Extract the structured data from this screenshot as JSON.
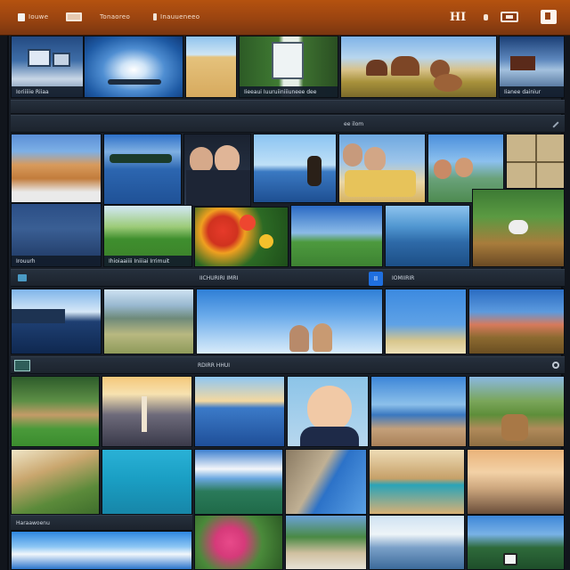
{
  "app": {
    "menu": [
      {
        "label": "Iouwe",
        "icon": "folder-icon"
      },
      {
        "label": "",
        "icon": "image-icon"
      },
      {
        "label": "Tonaoreo",
        "icon": ""
      },
      {
        "label": "Inauueneeo",
        "icon": "menu-icon"
      }
    ],
    "actions": {
      "grid_label": "HI",
      "share_icon": "share-icon",
      "user_icon": "person-icon",
      "close_icon": "close-icon"
    },
    "accent": "#a44a10"
  },
  "sections": {
    "s1": {
      "title": "",
      "right_label": "ee ilom"
    },
    "s2": {
      "title": "",
      "center_label": "IICHURIRI IMRI",
      "count_badge": "II",
      "right_label": "IOMIIRIR"
    },
    "s3": {
      "title": "",
      "center_label": "RDIRR HHUI"
    },
    "s4": {
      "title": "Haraawoenu"
    }
  },
  "captions": {
    "r1_t1": "Ioriiiiie Riiaa",
    "r1_t4": "Iieeaui Iuuruiiniiiuneee dee",
    "r1_t6": "Iianee dainiur",
    "r2_t8": "Irouurh",
    "r2_t9": "Ihioiaaiiii   Iniiiai  Irrimuit"
  },
  "colors": {
    "caption_bg": "#121c2a",
    "strip_bg": "#222b36",
    "badge_blue": "#1f6fe0"
  }
}
